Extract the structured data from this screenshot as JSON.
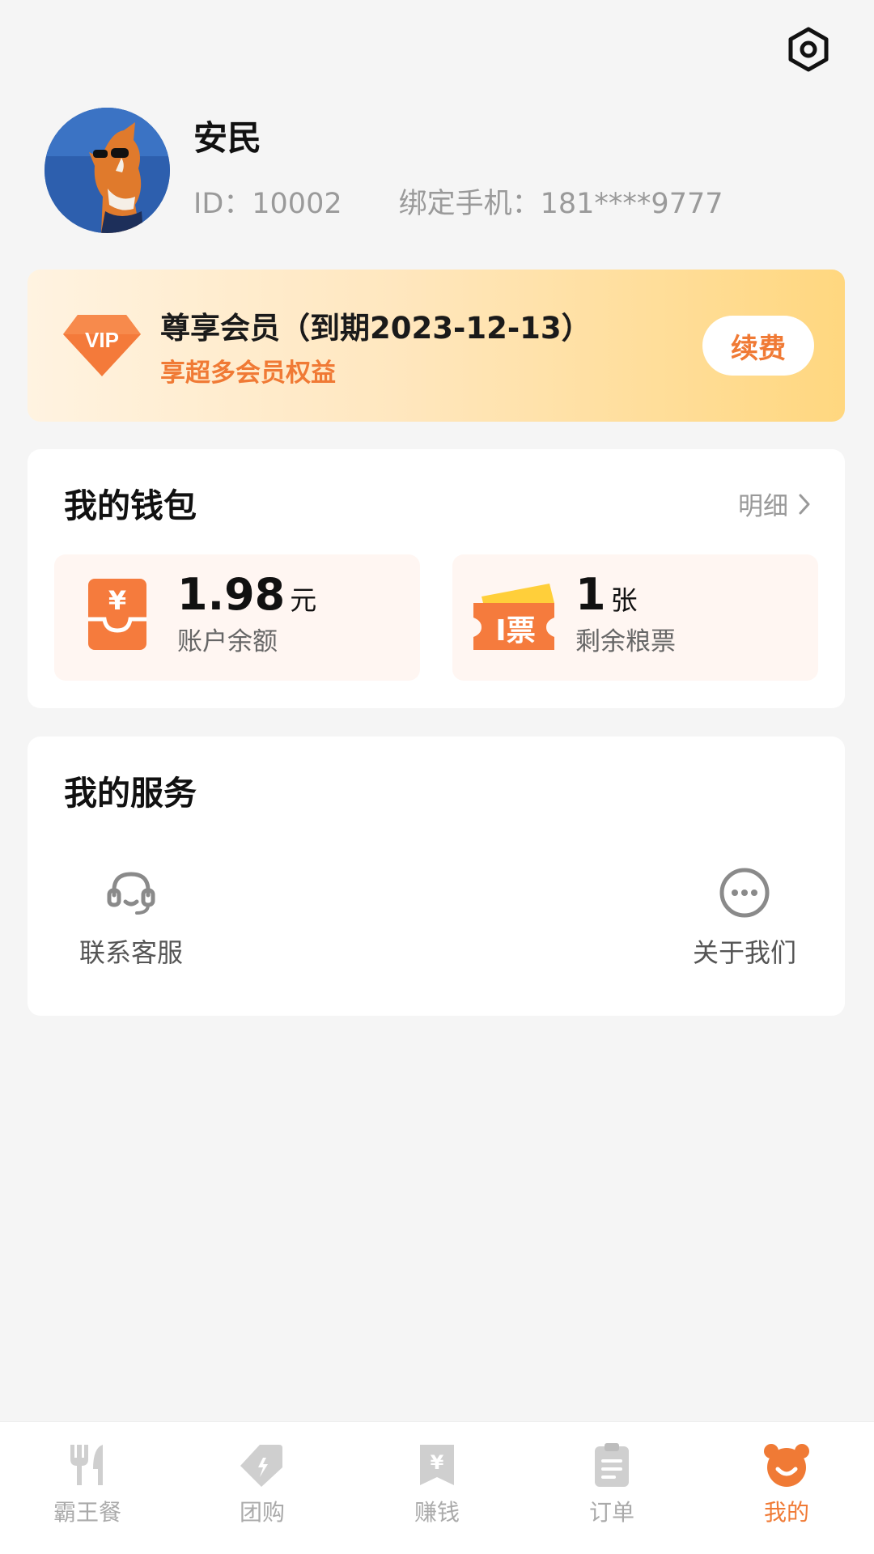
{
  "colors": {
    "accent": "#f07a35",
    "background": "#f5f5f5",
    "vip_gradient_start": "#fff3e1",
    "vip_gradient_end": "#ffd77f"
  },
  "header": {
    "settings_icon": "settings-hexagon-icon"
  },
  "profile": {
    "name": "安民",
    "id_text": "ID：10002",
    "phone_text": "绑定手机：181****9777",
    "avatar_icon": "dog-with-sunglasses-avatar"
  },
  "vip": {
    "badge_text": "VIP",
    "title": "尊享会员（到期2023-12-13）",
    "subtitle": "享超多会员权益",
    "renew_label": "续费"
  },
  "wallet": {
    "title": "我的钱包",
    "detail_label": "明细",
    "balance": {
      "value": "1.98",
      "unit": "元",
      "label": "账户余额",
      "icon": "yuan-wallet-icon"
    },
    "tickets": {
      "value": "1",
      "unit": "张",
      "label": "剩余粮票",
      "icon_text": "I票",
      "icon": "ticket-icon"
    }
  },
  "services": {
    "title": "我的服务",
    "items": [
      {
        "label": "联系客服",
        "icon": "headset-icon"
      },
      {
        "label": "关于我们",
        "icon": "more-circle-icon"
      }
    ]
  },
  "tabbar": {
    "items": [
      {
        "label": "霸王餐",
        "icon": "fork-knife-icon",
        "active": false
      },
      {
        "label": "团购",
        "icon": "coupon-tag-icon",
        "active": false
      },
      {
        "label": "赚钱",
        "icon": "yuan-bookmark-icon",
        "active": false
      },
      {
        "label": "订单",
        "icon": "clipboard-icon",
        "active": false
      },
      {
        "label": "我的",
        "icon": "bear-face-icon",
        "active": true
      }
    ]
  }
}
